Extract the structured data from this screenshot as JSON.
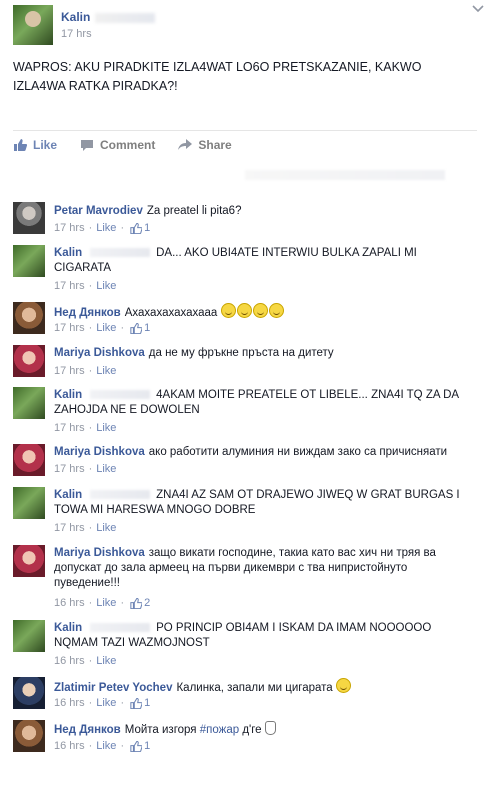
{
  "post": {
    "author": "Kalin",
    "time": "17 hrs",
    "menu_icon": "chevron-down-icon",
    "text": "WAPROS: AKU PIRADKITE IZLA4WAT LO6O PRETSKAZANIE, KAKWO IZLA4WA RATKA PIRADKA?!",
    "actions": {
      "like": "Like",
      "comment": "Comment",
      "share": "Share"
    }
  },
  "comments": [
    {
      "name": "Petar Mavrodiev",
      "text": "Za preatel li pita6?",
      "time": "17 hrs",
      "like": "Like",
      "likes": "1"
    },
    {
      "name": "Kalin",
      "text": "DA... AKO UBI4ATE INTERWIU BULKA ZAPALI MI CIGARATA",
      "time": "17 hrs",
      "like": "Like",
      "likes": ""
    },
    {
      "name": "Нед Дянков",
      "text": "Ахахахахахахааа",
      "time": "17 hrs",
      "like": "Like",
      "likes": "1"
    },
    {
      "name": "Mariya Dishkova",
      "text": "да не му фръкне пръста на дитету",
      "time": "17 hrs",
      "like": "Like",
      "likes": ""
    },
    {
      "name": "Kalin",
      "text": "4AKAM MOITE PREATELE OT LIBELE... ZNA4I TQ ZA DA ZAHOJDA NE E DOWOLEN",
      "time": "17 hrs",
      "like": "Like",
      "likes": ""
    },
    {
      "name": "Mariya Dishkova",
      "text": "ако работити алуминия ни виждам зако са причисняати",
      "time": "17 hrs",
      "like": "Like",
      "likes": ""
    },
    {
      "name": "Kalin",
      "text": "ZNA4I AZ SAM OT DRAJEWO JIWEQ W GRAT BURGAS I TOWA MI HARESWA MNOGO DOBRE",
      "time": "17 hrs",
      "like": "Like",
      "likes": ""
    },
    {
      "name": "Mariya Dishkova",
      "text": "защо викати господине, такиа като вас хич ни тряя ва допускат до зала армеец на първи дикември с тва нипристойнуто пуведение!!!",
      "time": "16 hrs",
      "like": "Like",
      "likes": "2"
    },
    {
      "name": "Kalin",
      "text": "PO PRINCIP OBI4AM I ISKAM DA IMAM NOOOOOO NQMAM TAZI WAZMOJNOST",
      "time": "16 hrs",
      "like": "Like",
      "likes": ""
    },
    {
      "name": "Zlatimir Petev Yochev",
      "text": "Калинка, запали ми цигарата",
      "time": "16 hrs",
      "like": "Like",
      "likes": "1"
    },
    {
      "name": "Нед Дянков",
      "text": "Мойта изгоря",
      "hashtag": "#пожар",
      "text_after": "д'ге",
      "time": "16 hrs",
      "like": "Like",
      "likes": "1"
    }
  ]
}
